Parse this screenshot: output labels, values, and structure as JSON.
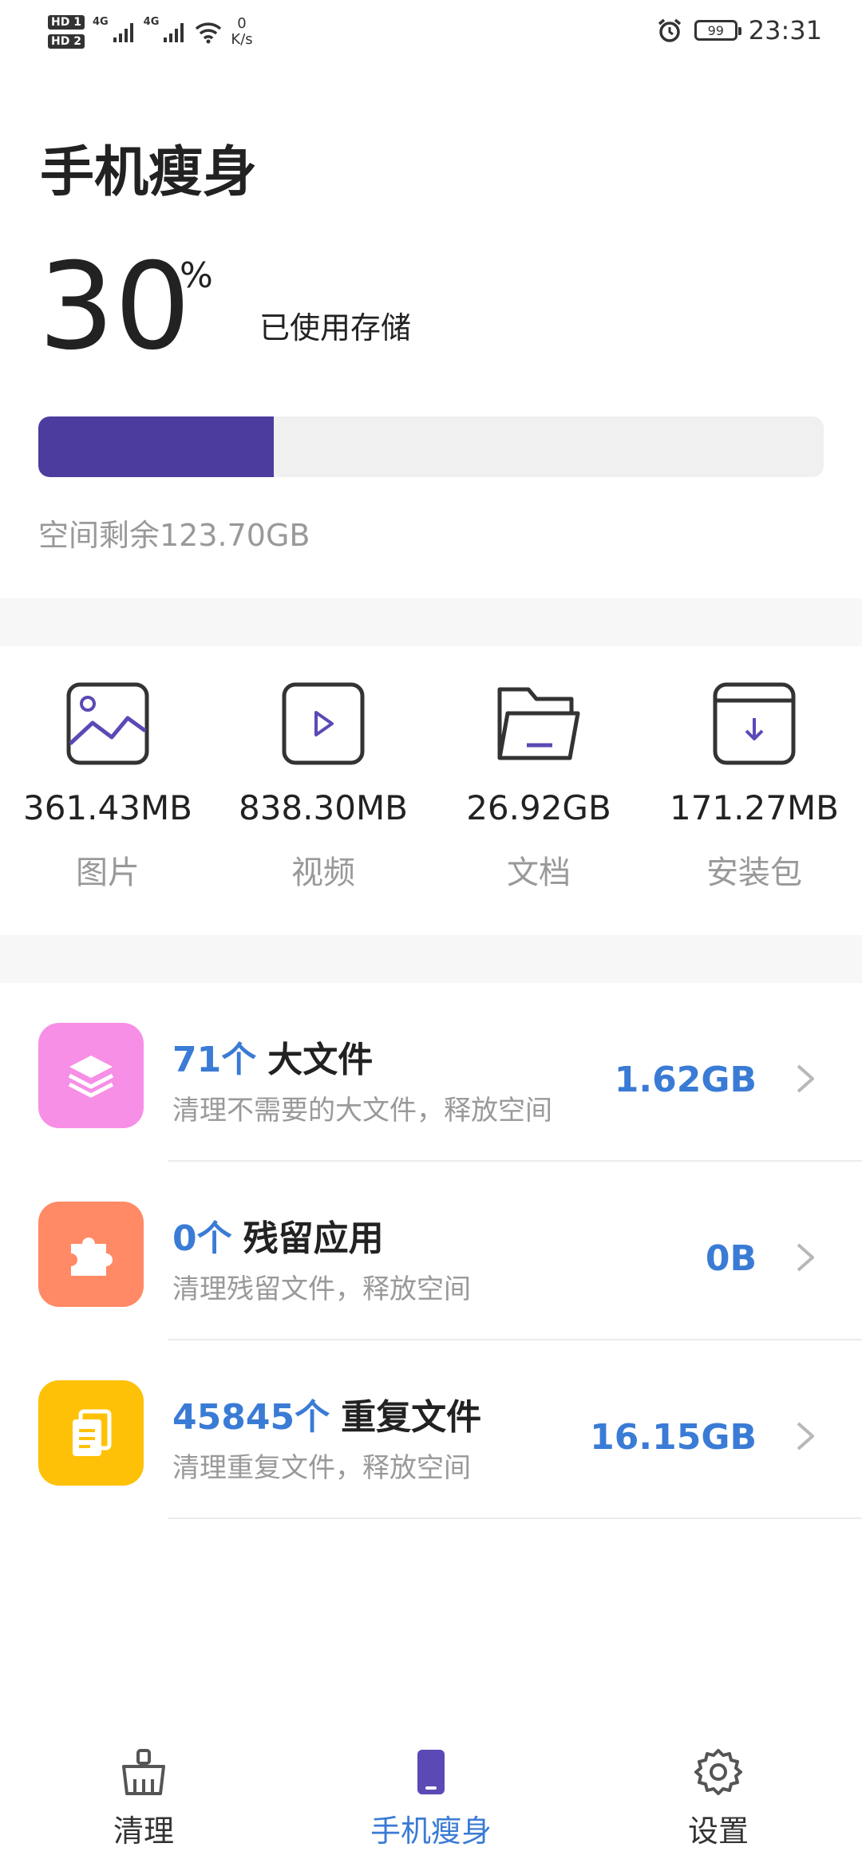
{
  "status_bar": {
    "sim1": "HD 1",
    "sim2": "HD 2",
    "net1": "4G",
    "net2": "4G",
    "speed_value": "0",
    "speed_unit": "K/s",
    "battery": "99",
    "time": "23:31"
  },
  "header": {
    "title": "手机瘦身",
    "used_percent": "30",
    "percent_symbol": "%",
    "used_label": "已使用存储",
    "usage_fraction": 0.3,
    "remaining": "空间剩余123.70GB"
  },
  "categories": [
    {
      "size": "361.43MB",
      "label": "图片",
      "icon": "image-icon"
    },
    {
      "size": "838.30MB",
      "label": "视频",
      "icon": "video-icon"
    },
    {
      "size": "26.92GB",
      "label": "文档",
      "icon": "folder-icon"
    },
    {
      "size": "171.27MB",
      "label": "安装包",
      "icon": "package-icon"
    }
  ],
  "items": [
    {
      "count": "71个",
      "name": "大文件",
      "desc": "清理不需要的大文件，释放空间",
      "size": "1.62GB",
      "icon": "layers-icon",
      "color": "#f78fe6"
    },
    {
      "count": "0个",
      "name": "残留应用",
      "desc": "清理残留文件，释放空间",
      "size": "0B",
      "icon": "puzzle-icon",
      "color": "#ff8a65"
    },
    {
      "count": "45845个",
      "name": "重复文件",
      "desc": "清理重复文件，释放空间",
      "size": "16.15GB",
      "icon": "duplicate-files-icon",
      "color": "#ffc107"
    }
  ],
  "nav": [
    {
      "label": "清理",
      "icon": "broom-icon"
    },
    {
      "label": "手机瘦身",
      "icon": "phone-icon",
      "active": true
    },
    {
      "label": "设置",
      "icon": "gear-icon"
    }
  ],
  "colors": {
    "accent": "#3a7bd5",
    "progress": "#4b3c9d",
    "category_icon_stroke": "#333333",
    "category_icon_accent": "#5b49b5"
  }
}
